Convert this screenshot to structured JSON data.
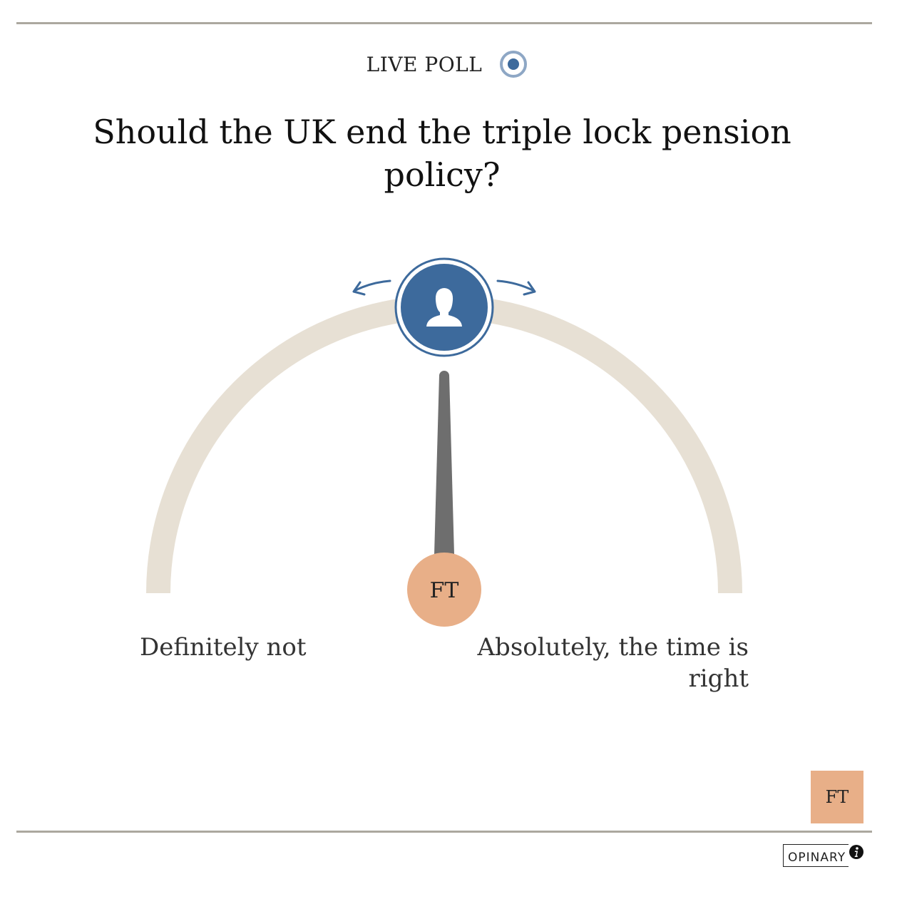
{
  "poll": {
    "status_label": "LIVE POLL",
    "question": "Should the UK end the triple lock pension policy?",
    "scale_left_label": "Definitely not",
    "scale_right_label": "Absolutely, the time is right",
    "needle_value": 0.5,
    "needle_marker_label": "FT"
  },
  "icons": {
    "live": "radio-target-icon",
    "handle": "user-silhouette-icon",
    "drag_left": "curved-arrow-left-icon",
    "drag_right": "curved-arrow-right-icon",
    "info": "info-icon"
  },
  "branding": {
    "publisher_badge": "FT",
    "provider": "OPINARY"
  },
  "colors": {
    "accent_blue": "#3d6a9c",
    "arc": "#e7e0d4",
    "needle": "#6e6e6e",
    "ft_salmon": "#e8af88",
    "rule": "#aca89f"
  }
}
